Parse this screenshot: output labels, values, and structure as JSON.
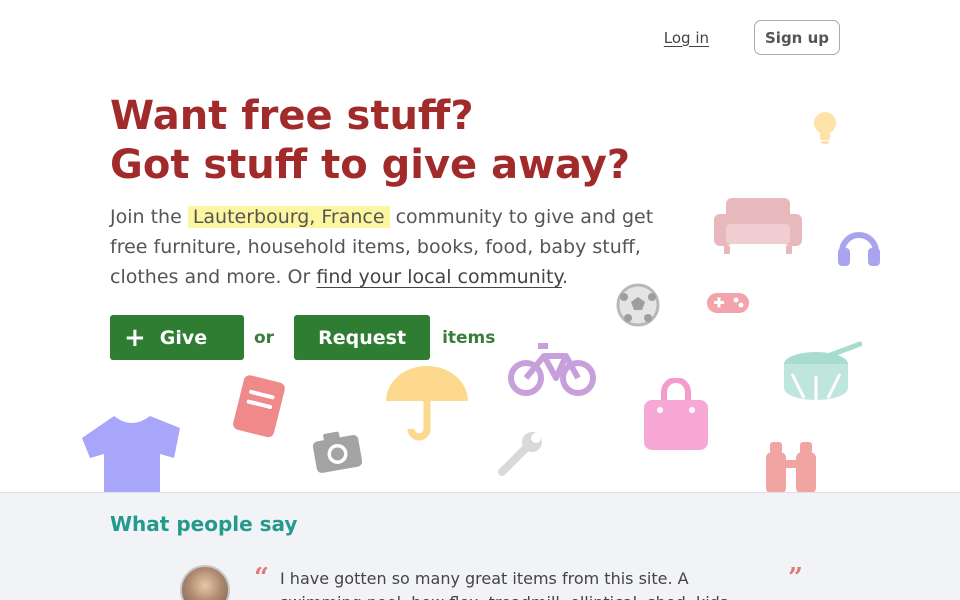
{
  "nav": {
    "login": "Log in",
    "signup": "Sign up"
  },
  "hero": {
    "headline_line1": "Want free stuff?",
    "headline_line2": "Got stuff to give away?",
    "intro_before": "Join the ",
    "location": "Lauterbourg, France",
    "intro_after": " community to give and get free furniture, household items, books, food, baby stuff, clothes and more. Or ",
    "find_link": "find your local community",
    "intro_end": ".",
    "give_plus": "+",
    "give_label": "Give",
    "or": "or",
    "request_label": "Request",
    "items": "items"
  },
  "icons": [
    "lightbulb-icon",
    "sofa-icon",
    "headphones-icon",
    "soccer-ball-icon",
    "gamepad-icon",
    "bicycle-icon",
    "book-icon",
    "umbrella-icon",
    "shopping-bag-icon",
    "drum-icon",
    "tshirt-icon",
    "camera-icon",
    "wrench-icon",
    "binoculars-icon"
  ],
  "testimonials": {
    "heading": "What people say",
    "quote_open": "“",
    "quote_close": "”",
    "quote": "I have gotten so many great items from this site. A swimming pool, bow flex, treadmill, elliptical, shed, kids"
  },
  "colors": {
    "headline": "#a12a2a",
    "primary_button": "#2e7d32",
    "location_highlight": "#fcf6a0",
    "testimonials_heading": "#239a8c",
    "testimonials_bg": "#f2f3f7"
  }
}
